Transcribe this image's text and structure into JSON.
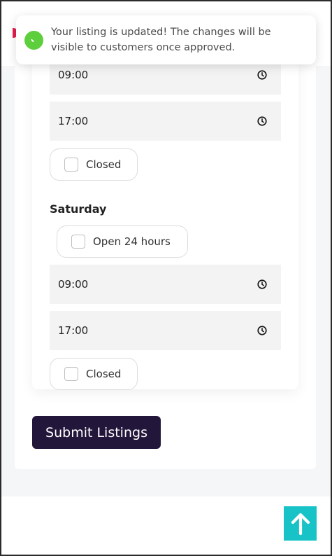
{
  "toast": {
    "message": "Your listing is updated! The changes will be visible to customers once approved."
  },
  "friday": {
    "open_time": "09:00",
    "close_time": "17:00",
    "closed_label": "Closed"
  },
  "saturday": {
    "day_label": "Saturday",
    "open24_label": "Open 24 hours",
    "open_time": "09:00",
    "close_time": "17:00",
    "closed_label": "Closed"
  },
  "actions": {
    "submit_label": "Submit Listings"
  },
  "icons": {
    "clock": "clock-icon",
    "scroll_top": "arrow-up-icon",
    "toast_status": "success-dot-icon"
  },
  "colors": {
    "submit_bg": "#23163b",
    "scroll_top_bg": "#18c3c8",
    "toast_status": "#5dce3c"
  }
}
